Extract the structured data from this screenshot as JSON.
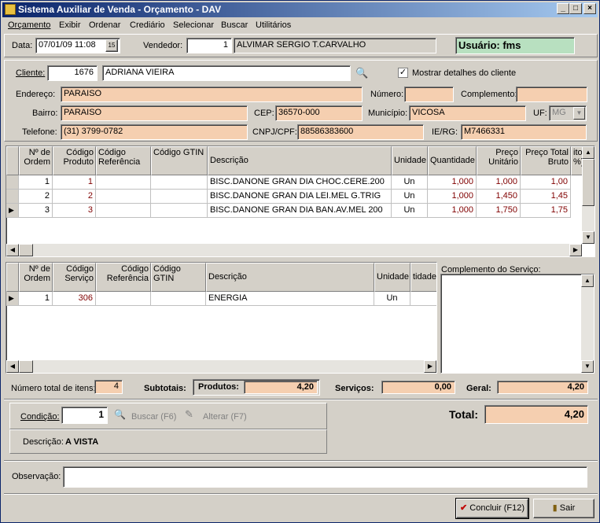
{
  "window": {
    "title": "Sistema Auxiliar de Venda - Orçamento - DAV",
    "min": "_",
    "max": "□",
    "close": "×"
  },
  "menu": [
    "Orçamento",
    "Exibir",
    "Ordenar",
    "Crediário",
    "Selecionar",
    "Buscar",
    "Utilitários"
  ],
  "header": {
    "data_label": "Data:",
    "data_value": "07/01/09 11:08",
    "calendar_btn": "15",
    "vendedor_label": "Vendedor:",
    "vendedor_code": "1",
    "vendedor_name": "ALVIMAR SERGIO T.CARVALHO",
    "usuario": "Usuário: fms"
  },
  "cliente": {
    "label": "Cliente:",
    "code": "1676",
    "name": "ADRIANA VIEIRA",
    "show_details": "Mostrar detalhes do cliente",
    "endereco_label": "Endereço:",
    "endereco": "PARAISO",
    "numero_label": "Número:",
    "numero": "",
    "complemento_label": "Complemento:",
    "complemento": "",
    "bairro_label": "Bairro:",
    "bairro": "PARAISO",
    "cep_label": "CEP:",
    "cep": "36570-000",
    "municipio_label": "Município:",
    "municipio": "VICOSA",
    "uf_label": "UF:",
    "uf": "MG",
    "telefone_label": "Telefone:",
    "telefone": "(31) 3799-0782",
    "cnpj_label": "CNPJ/CPF:",
    "cnpj": "88586383600",
    "ie_label": "IE/RG:",
    "ie": "M7466331"
  },
  "products": {
    "headers": [
      "Nº de Ordem",
      "Código Produto",
      "Código Referência",
      "Código GTIN",
      "Descrição",
      "Unidade",
      "Quantidade",
      "Preço Unitário",
      "Preço Total Bruto",
      "ito %)"
    ],
    "rows": [
      {
        "ordem": "1",
        "codigo": "1",
        "ref": "",
        "gtin": "",
        "desc": "BISC.DANONE GRAN DIA CHOC.CERE.200",
        "un": "Un",
        "qtd": "1,000",
        "unit": "1,000",
        "total": "1,00"
      },
      {
        "ordem": "2",
        "codigo": "2",
        "ref": "",
        "gtin": "",
        "desc": "BISC.DANONE GRAN DIA LEI.MEL G.TRIG",
        "un": "Un",
        "qtd": "1,000",
        "unit": "1,450",
        "total": "1,45"
      },
      {
        "ordem": "3",
        "codigo": "3",
        "ref": "",
        "gtin": "",
        "desc": "BISC.DANONE GRAN DIA BAN.AV.MEL 200",
        "un": "Un",
        "qtd": "1,000",
        "unit": "1,750",
        "total": "1,75"
      }
    ]
  },
  "services": {
    "headers": [
      "Nº de Ordem",
      "Código Serviço",
      "Código Referência",
      "Código GTIN",
      "Descrição",
      "Unidade",
      "tidade"
    ],
    "rows": [
      {
        "ordem": "1",
        "codigo": "306",
        "ref": "",
        "gtin": "",
        "desc": "ENERGIA",
        "un": "Un",
        "qtd": ""
      }
    ],
    "complemento_label": "Complemento do Serviço:"
  },
  "totals": {
    "num_itens_label": "Número total de itens:",
    "num_itens": "4",
    "subtotais_label": "Subtotais:",
    "produtos_label": "Produtos:",
    "produtos": "4,20",
    "servicos_label": "Serviços:",
    "servicos": "0,00",
    "geral_label": "Geral:",
    "geral": "4,20",
    "total_label": "Total:",
    "total": "4,20"
  },
  "condicao": {
    "label": "Condição:",
    "value": "1",
    "buscar": "Buscar (F6)",
    "alterar": "Alterar (F7)",
    "descricao_label": "Descrição:",
    "descricao": "A VISTA"
  },
  "observacao": {
    "label": "Observação:",
    "value": ""
  },
  "buttons": {
    "concluir": "Concluir (F12)",
    "sair": "Sair"
  }
}
